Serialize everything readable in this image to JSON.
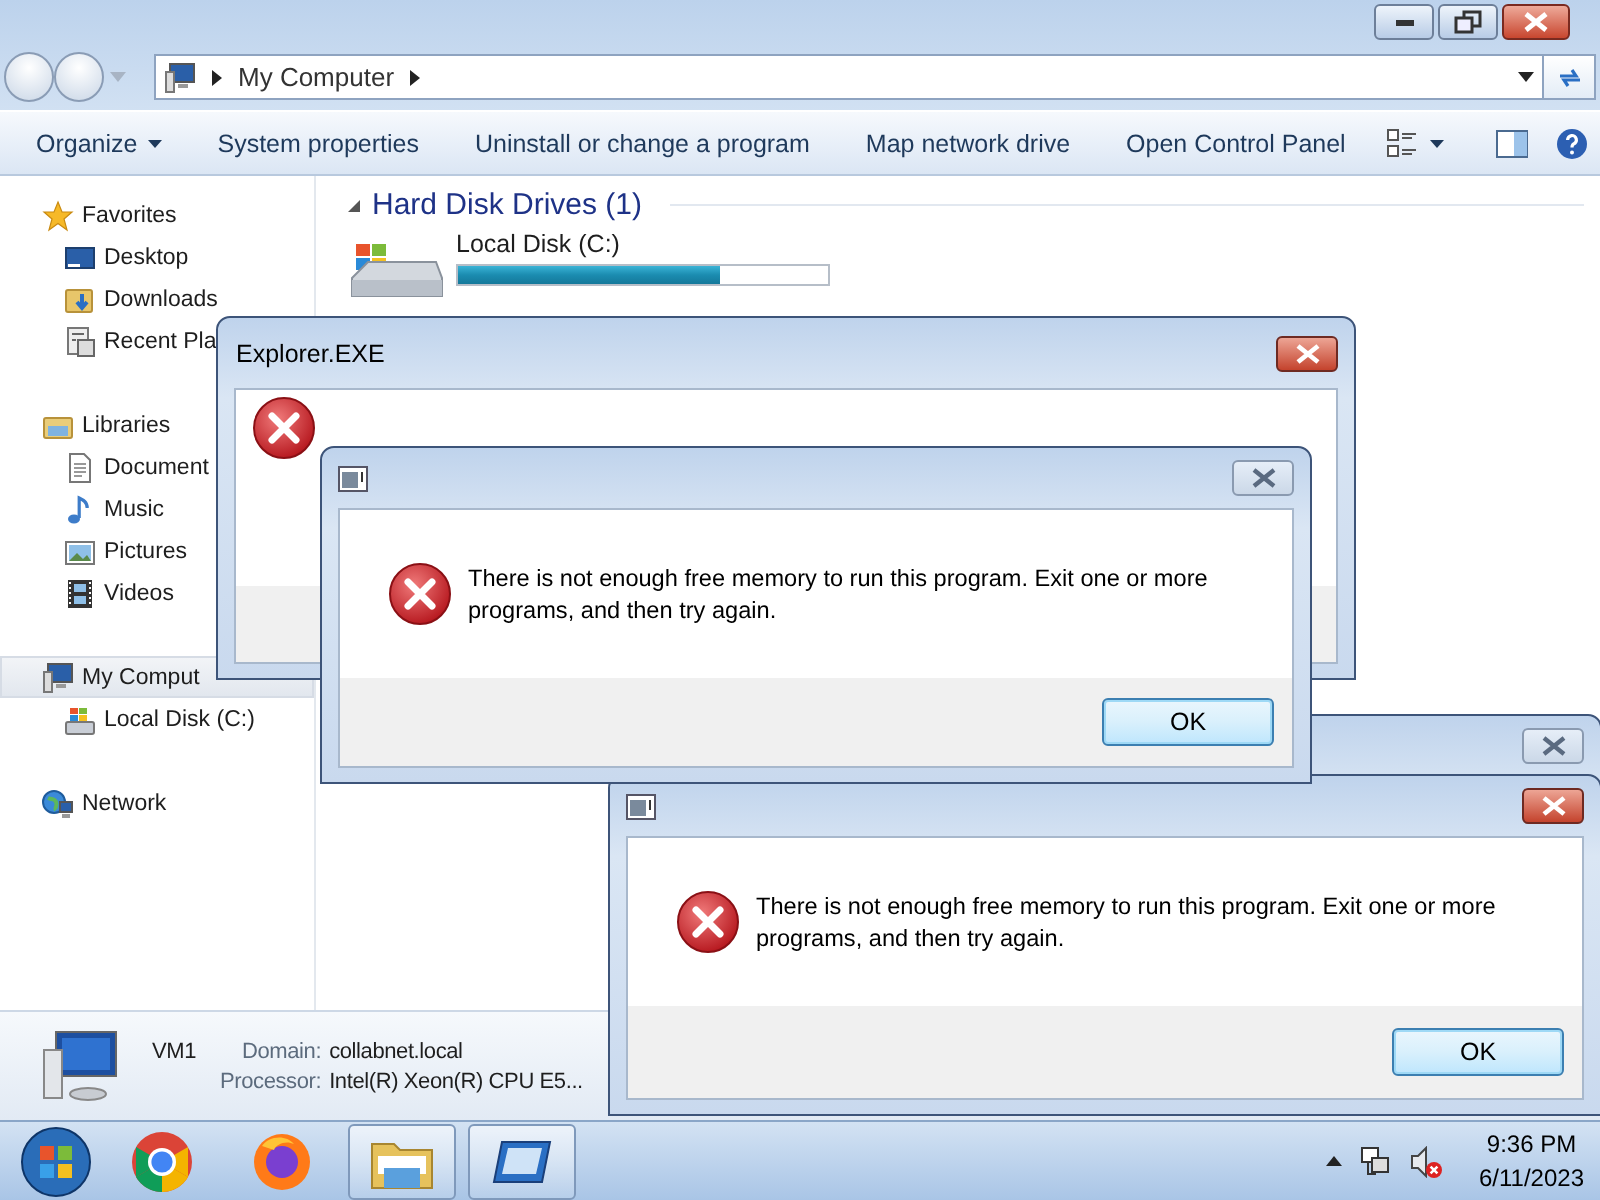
{
  "explorer": {
    "address": {
      "crumbs": [
        "My Computer"
      ]
    },
    "toolbar": [
      {
        "label": "Organize",
        "menu": true
      },
      {
        "label": "System properties",
        "menu": false
      },
      {
        "label": "Uninstall or change a program",
        "menu": false
      },
      {
        "label": "Map network drive",
        "menu": false
      },
      {
        "label": "Open Control Panel",
        "menu": false
      }
    ],
    "sidebar": [
      {
        "label": "Favorites",
        "kind": "star",
        "selected": false,
        "children": [
          {
            "label": "Desktop",
            "kind": "desktop",
            "selected": false
          },
          {
            "label": "Downloads",
            "kind": "download",
            "selected": false
          },
          {
            "label": "Recent Pla",
            "kind": "recent",
            "selected": false
          }
        ]
      },
      {
        "label": "Libraries",
        "kind": "library",
        "selected": false,
        "children": [
          {
            "label": "Document",
            "kind": "document",
            "selected": false
          },
          {
            "label": "Music",
            "kind": "music",
            "selected": false
          },
          {
            "label": "Pictures",
            "kind": "pictures",
            "selected": false
          },
          {
            "label": "Videos",
            "kind": "videos",
            "selected": false
          }
        ]
      },
      {
        "label": "My Comput",
        "kind": "computer",
        "selected": true,
        "children": [
          {
            "label": "Local Disk (C:)",
            "kind": "disk",
            "selected": false
          }
        ]
      },
      {
        "label": "Network",
        "kind": "network",
        "selected": false
      }
    ],
    "section": {
      "title": "Hard Disk Drives (1)",
      "drives": [
        {
          "name": "Local Disk (C:)",
          "level": 0.71
        }
      ]
    },
    "details": {
      "name": "VM1",
      "fields": [
        {
          "label": "Domain:",
          "value": "collabnet.local"
        },
        {
          "label": "Processor:",
          "value": "Intel(R) Xeon(R) CPU E5..."
        }
      ]
    }
  },
  "dialogs": [
    {
      "title": "Explorer.EXE",
      "active": true,
      "app_icon": false,
      "kind": "error"
    },
    {
      "active": false,
      "app_icon": true,
      "kind": "error",
      "message": "There is not enough free memory to run this program. Exit one or more programs, and then try again.",
      "button": "OK"
    },
    {
      "active": false,
      "app_icon": false
    },
    {
      "active": true,
      "app_icon": true,
      "kind": "error",
      "message": "There is not enough free memory to run this program. Exit one or more programs, and then try again.",
      "button": "OK"
    }
  ],
  "taskbar": {
    "apps": [
      {
        "kind": "chrome",
        "running": false
      },
      {
        "kind": "firefox",
        "running": false
      },
      {
        "kind": "explorer",
        "running": true
      },
      {
        "kind": "window",
        "running": true
      }
    ],
    "time": "9:36 PM",
    "date": "6/11/2023"
  }
}
